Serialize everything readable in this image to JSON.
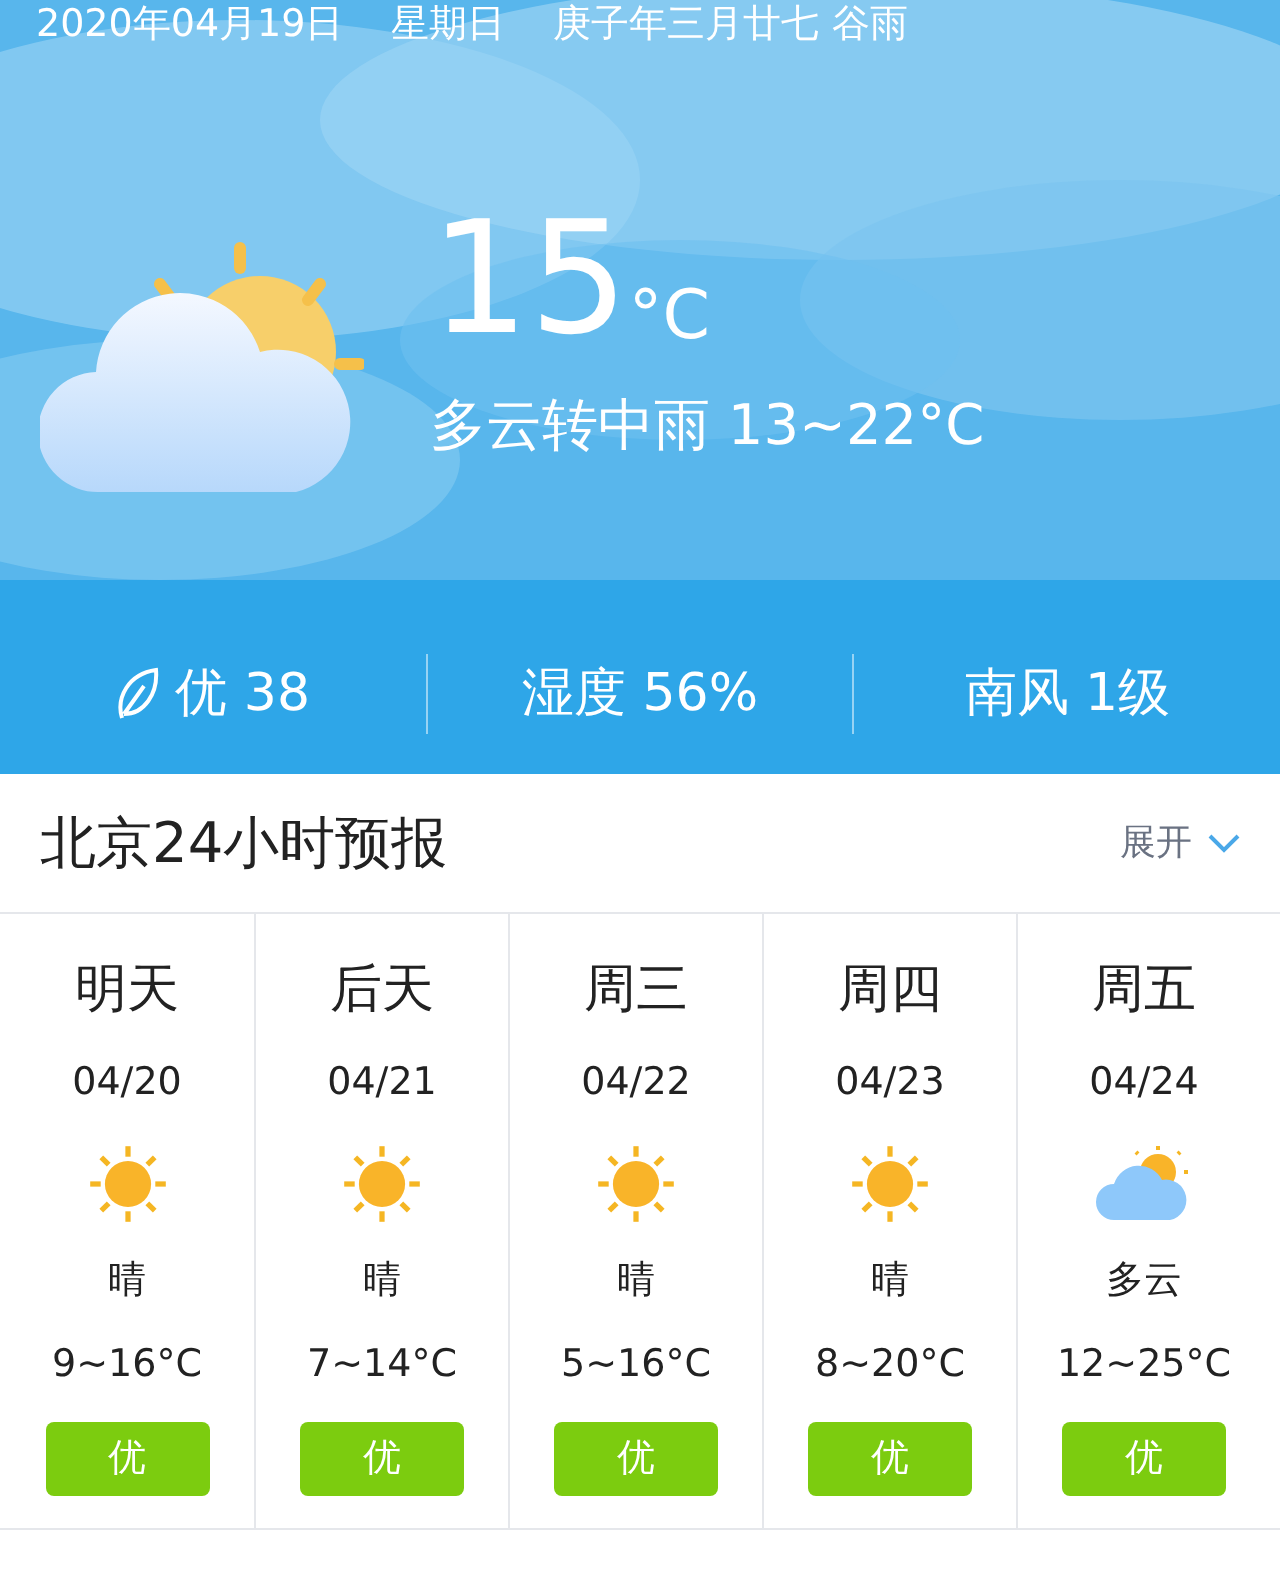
{
  "header": {
    "date": "2020年04月19日",
    "weekday": "星期日",
    "lunar": "庚子年三月廿七 谷雨",
    "temperature": "15",
    "unit": "°C",
    "condition": "多云转中雨 13~22°C",
    "kind": "partly_cloudy"
  },
  "stats": [
    {
      "kind": "air",
      "text": "优 38"
    },
    {
      "kind": "plain",
      "text": "湿度 56%"
    },
    {
      "kind": "plain",
      "text": "南风 1级"
    }
  ],
  "forecast": {
    "title": "北京24小时预报",
    "toggle": "展开",
    "expanded": false,
    "days": [
      {
        "day": "明天",
        "date": "04/20",
        "kind": "sunny",
        "condition": "晴",
        "range": "9~16°C",
        "air": "优"
      },
      {
        "day": "后天",
        "date": "04/21",
        "kind": "sunny",
        "condition": "晴",
        "range": "7~14°C",
        "air": "优"
      },
      {
        "day": "周三",
        "date": "04/22",
        "kind": "sunny",
        "condition": "晴",
        "range": "5~16°C",
        "air": "优"
      },
      {
        "day": "周四",
        "date": "04/23",
        "kind": "sunny",
        "condition": "晴",
        "range": "8~20°C",
        "air": "优"
      },
      {
        "day": "周五",
        "date": "04/24",
        "kind": "partly_cloudy",
        "condition": "多云",
        "range": "12~25°C",
        "air": "优"
      }
    ]
  }
}
